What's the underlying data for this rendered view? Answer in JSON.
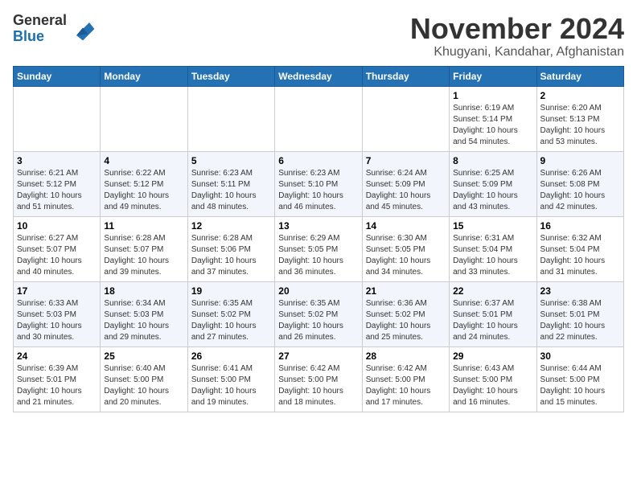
{
  "header": {
    "logo_general": "General",
    "logo_blue": "Blue",
    "month_title": "November 2024",
    "location": "Khugyani, Kandahar, Afghanistan"
  },
  "weekdays": [
    "Sunday",
    "Monday",
    "Tuesday",
    "Wednesday",
    "Thursday",
    "Friday",
    "Saturday"
  ],
  "weeks": [
    [
      {
        "day": "",
        "info": ""
      },
      {
        "day": "",
        "info": ""
      },
      {
        "day": "",
        "info": ""
      },
      {
        "day": "",
        "info": ""
      },
      {
        "day": "",
        "info": ""
      },
      {
        "day": "1",
        "info": "Sunrise: 6:19 AM\nSunset: 5:14 PM\nDaylight: 10 hours\nand 54 minutes."
      },
      {
        "day": "2",
        "info": "Sunrise: 6:20 AM\nSunset: 5:13 PM\nDaylight: 10 hours\nand 53 minutes."
      }
    ],
    [
      {
        "day": "3",
        "info": "Sunrise: 6:21 AM\nSunset: 5:12 PM\nDaylight: 10 hours\nand 51 minutes."
      },
      {
        "day": "4",
        "info": "Sunrise: 6:22 AM\nSunset: 5:12 PM\nDaylight: 10 hours\nand 49 minutes."
      },
      {
        "day": "5",
        "info": "Sunrise: 6:23 AM\nSunset: 5:11 PM\nDaylight: 10 hours\nand 48 minutes."
      },
      {
        "day": "6",
        "info": "Sunrise: 6:23 AM\nSunset: 5:10 PM\nDaylight: 10 hours\nand 46 minutes."
      },
      {
        "day": "7",
        "info": "Sunrise: 6:24 AM\nSunset: 5:09 PM\nDaylight: 10 hours\nand 45 minutes."
      },
      {
        "day": "8",
        "info": "Sunrise: 6:25 AM\nSunset: 5:09 PM\nDaylight: 10 hours\nand 43 minutes."
      },
      {
        "day": "9",
        "info": "Sunrise: 6:26 AM\nSunset: 5:08 PM\nDaylight: 10 hours\nand 42 minutes."
      }
    ],
    [
      {
        "day": "10",
        "info": "Sunrise: 6:27 AM\nSunset: 5:07 PM\nDaylight: 10 hours\nand 40 minutes."
      },
      {
        "day": "11",
        "info": "Sunrise: 6:28 AM\nSunset: 5:07 PM\nDaylight: 10 hours\nand 39 minutes."
      },
      {
        "day": "12",
        "info": "Sunrise: 6:28 AM\nSunset: 5:06 PM\nDaylight: 10 hours\nand 37 minutes."
      },
      {
        "day": "13",
        "info": "Sunrise: 6:29 AM\nSunset: 5:05 PM\nDaylight: 10 hours\nand 36 minutes."
      },
      {
        "day": "14",
        "info": "Sunrise: 6:30 AM\nSunset: 5:05 PM\nDaylight: 10 hours\nand 34 minutes."
      },
      {
        "day": "15",
        "info": "Sunrise: 6:31 AM\nSunset: 5:04 PM\nDaylight: 10 hours\nand 33 minutes."
      },
      {
        "day": "16",
        "info": "Sunrise: 6:32 AM\nSunset: 5:04 PM\nDaylight: 10 hours\nand 31 minutes."
      }
    ],
    [
      {
        "day": "17",
        "info": "Sunrise: 6:33 AM\nSunset: 5:03 PM\nDaylight: 10 hours\nand 30 minutes."
      },
      {
        "day": "18",
        "info": "Sunrise: 6:34 AM\nSunset: 5:03 PM\nDaylight: 10 hours\nand 29 minutes."
      },
      {
        "day": "19",
        "info": "Sunrise: 6:35 AM\nSunset: 5:02 PM\nDaylight: 10 hours\nand 27 minutes."
      },
      {
        "day": "20",
        "info": "Sunrise: 6:35 AM\nSunset: 5:02 PM\nDaylight: 10 hours\nand 26 minutes."
      },
      {
        "day": "21",
        "info": "Sunrise: 6:36 AM\nSunset: 5:02 PM\nDaylight: 10 hours\nand 25 minutes."
      },
      {
        "day": "22",
        "info": "Sunrise: 6:37 AM\nSunset: 5:01 PM\nDaylight: 10 hours\nand 24 minutes."
      },
      {
        "day": "23",
        "info": "Sunrise: 6:38 AM\nSunset: 5:01 PM\nDaylight: 10 hours\nand 22 minutes."
      }
    ],
    [
      {
        "day": "24",
        "info": "Sunrise: 6:39 AM\nSunset: 5:01 PM\nDaylight: 10 hours\nand 21 minutes."
      },
      {
        "day": "25",
        "info": "Sunrise: 6:40 AM\nSunset: 5:00 PM\nDaylight: 10 hours\nand 20 minutes."
      },
      {
        "day": "26",
        "info": "Sunrise: 6:41 AM\nSunset: 5:00 PM\nDaylight: 10 hours\nand 19 minutes."
      },
      {
        "day": "27",
        "info": "Sunrise: 6:42 AM\nSunset: 5:00 PM\nDaylight: 10 hours\nand 18 minutes."
      },
      {
        "day": "28",
        "info": "Sunrise: 6:42 AM\nSunset: 5:00 PM\nDaylight: 10 hours\nand 17 minutes."
      },
      {
        "day": "29",
        "info": "Sunrise: 6:43 AM\nSunset: 5:00 PM\nDaylight: 10 hours\nand 16 minutes."
      },
      {
        "day": "30",
        "info": "Sunrise: 6:44 AM\nSunset: 5:00 PM\nDaylight: 10 hours\nand 15 minutes."
      }
    ]
  ]
}
